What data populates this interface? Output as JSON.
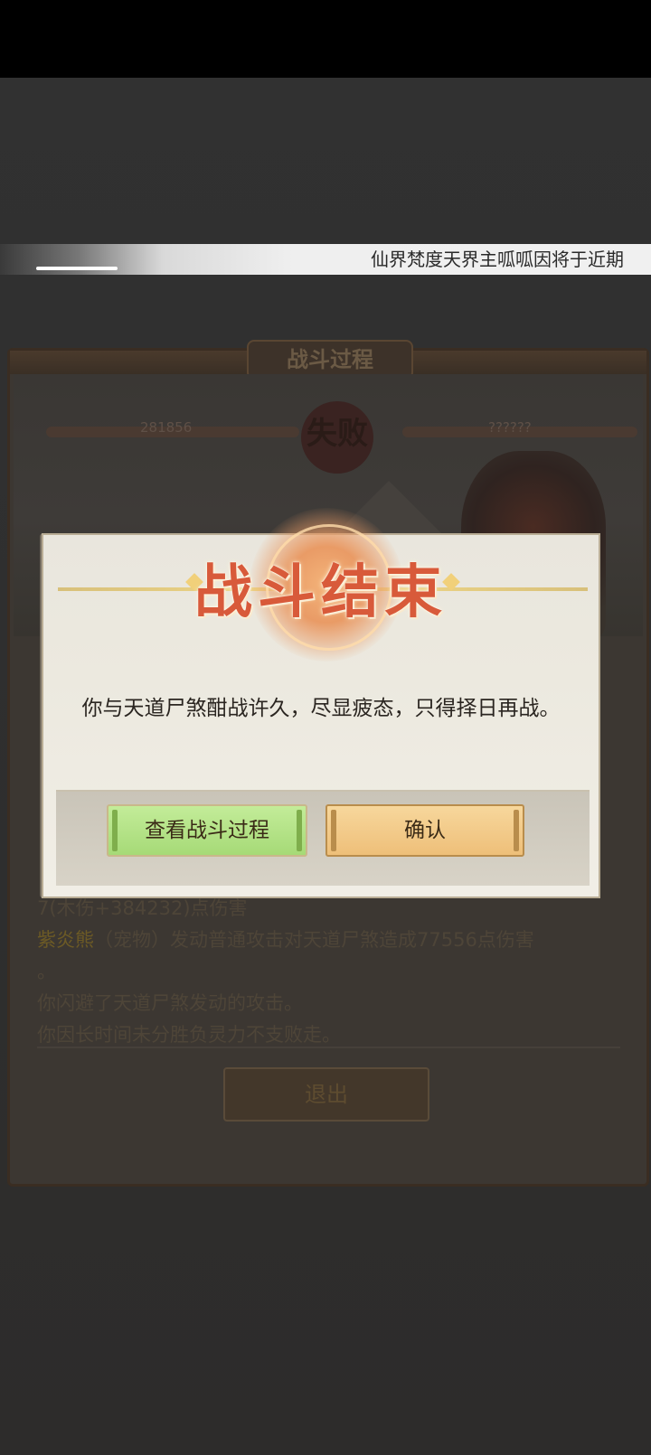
{
  "notice": {
    "text": "仙界梵度天界主呱呱因将于近期"
  },
  "battle_panel": {
    "title": "战斗过程",
    "player_hp": "281856",
    "enemy_hp": "??????",
    "result": "失败",
    "log_lines": [
      {
        "text": "7(木伤+384232)点伤害"
      },
      {
        "name": "紫炎熊",
        "text": "（宠物）发动普通攻击对天道尸煞造成77556点伤害"
      },
      {
        "text": "。"
      },
      {
        "text": "你闪避了天道尸煞发动的攻击。"
      },
      {
        "text": "你因长时间未分胜负灵力不支败走。"
      }
    ],
    "exit_label": "退出"
  },
  "modal": {
    "title": "战斗结束",
    "message": "你与天道尸煞酣战许久，尽显疲态，只得择日再战。",
    "view_process_label": "查看战斗过程",
    "confirm_label": "确认"
  },
  "colors": {
    "title_red": "#d85a3a",
    "green_button": "#b5e487",
    "gold_button": "#f3cd8b"
  }
}
